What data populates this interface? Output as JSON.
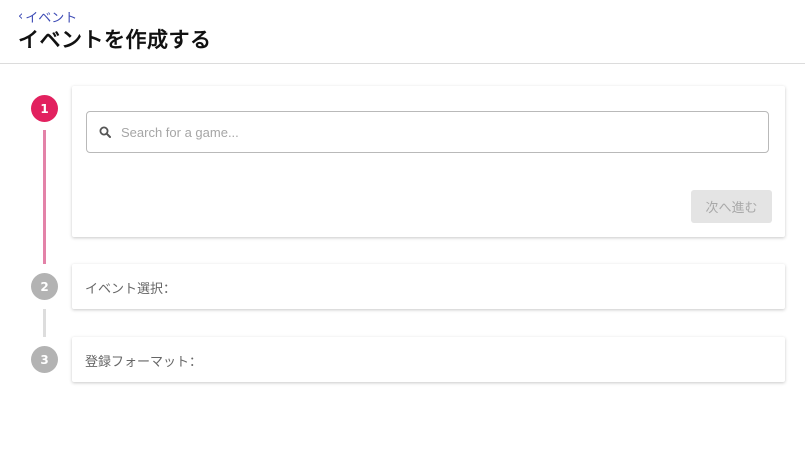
{
  "header": {
    "back_label": "イベント",
    "title": "イベントを作成する"
  },
  "steps": [
    {
      "number": "1",
      "state": "active"
    },
    {
      "number": "2",
      "state": "inactive",
      "label": "イベント選択："
    },
    {
      "number": "3",
      "state": "inactive",
      "label": "登録フォーマット："
    }
  ],
  "search": {
    "placeholder": "Search for a game...",
    "value": ""
  },
  "buttons": {
    "next_label": "次へ進む"
  },
  "colors": {
    "accent": "#e2215f",
    "connector_active": "#e382a8",
    "inactive_step": "#b3b3b3",
    "link": "#3d4bb5"
  },
  "icons": {
    "back": "chevron-left-icon",
    "search": "search-icon"
  }
}
